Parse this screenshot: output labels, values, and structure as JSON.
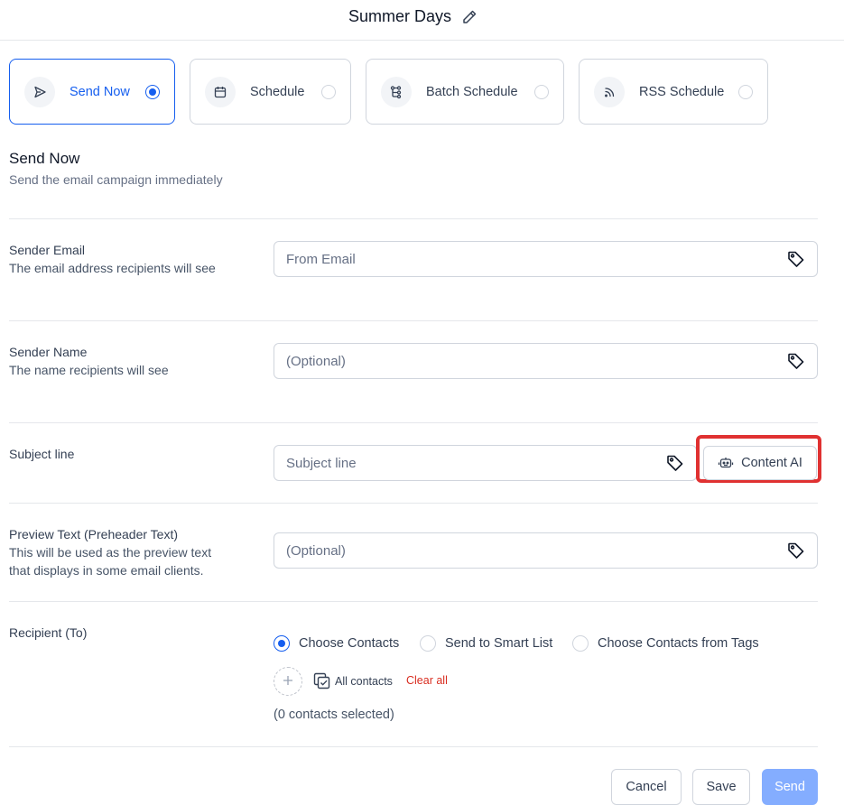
{
  "header": {
    "title": "Summer Days"
  },
  "send_options": [
    {
      "label": "Send Now",
      "icon": "send-icon",
      "selected": true
    },
    {
      "label": "Schedule",
      "icon": "calendar-icon",
      "selected": false
    },
    {
      "label": "Batch Schedule",
      "icon": "batch-icon",
      "selected": false
    },
    {
      "label": "RSS Schedule",
      "icon": "rss-icon",
      "selected": false
    }
  ],
  "section": {
    "title": "Send Now",
    "description": "Send the email campaign immediately"
  },
  "sender_email": {
    "label": "Sender Email",
    "description": "The email address recipients will see",
    "placeholder": "From Email",
    "value": ""
  },
  "sender_name": {
    "label": "Sender Name",
    "description": "The name recipients will see",
    "placeholder": "(Optional)",
    "value": ""
  },
  "subject": {
    "label": "Subject line",
    "placeholder": "Subject line",
    "value": "",
    "ai_button": "Content AI"
  },
  "preview_text": {
    "label": "Preview Text (Preheader Text)",
    "description_line1": "This will be used as the preview text",
    "description_line2": "that displays in some email clients.",
    "placeholder": "(Optional)",
    "value": ""
  },
  "recipient": {
    "label": "Recipient (To)",
    "options": [
      {
        "label": "Choose Contacts",
        "selected": true
      },
      {
        "label": "Send to Smart List",
        "selected": false
      },
      {
        "label": "Choose Contacts from Tags",
        "selected": false
      }
    ],
    "all_contacts": "All contacts",
    "clear_all": "Clear all",
    "count_text": "(0 contacts selected)"
  },
  "footer": {
    "cancel": "Cancel",
    "save": "Save",
    "send": "Send"
  },
  "colors": {
    "primary": "#155eef",
    "send_disabled": "#84adff",
    "highlight": "#e03131",
    "danger": "#d92d20"
  }
}
